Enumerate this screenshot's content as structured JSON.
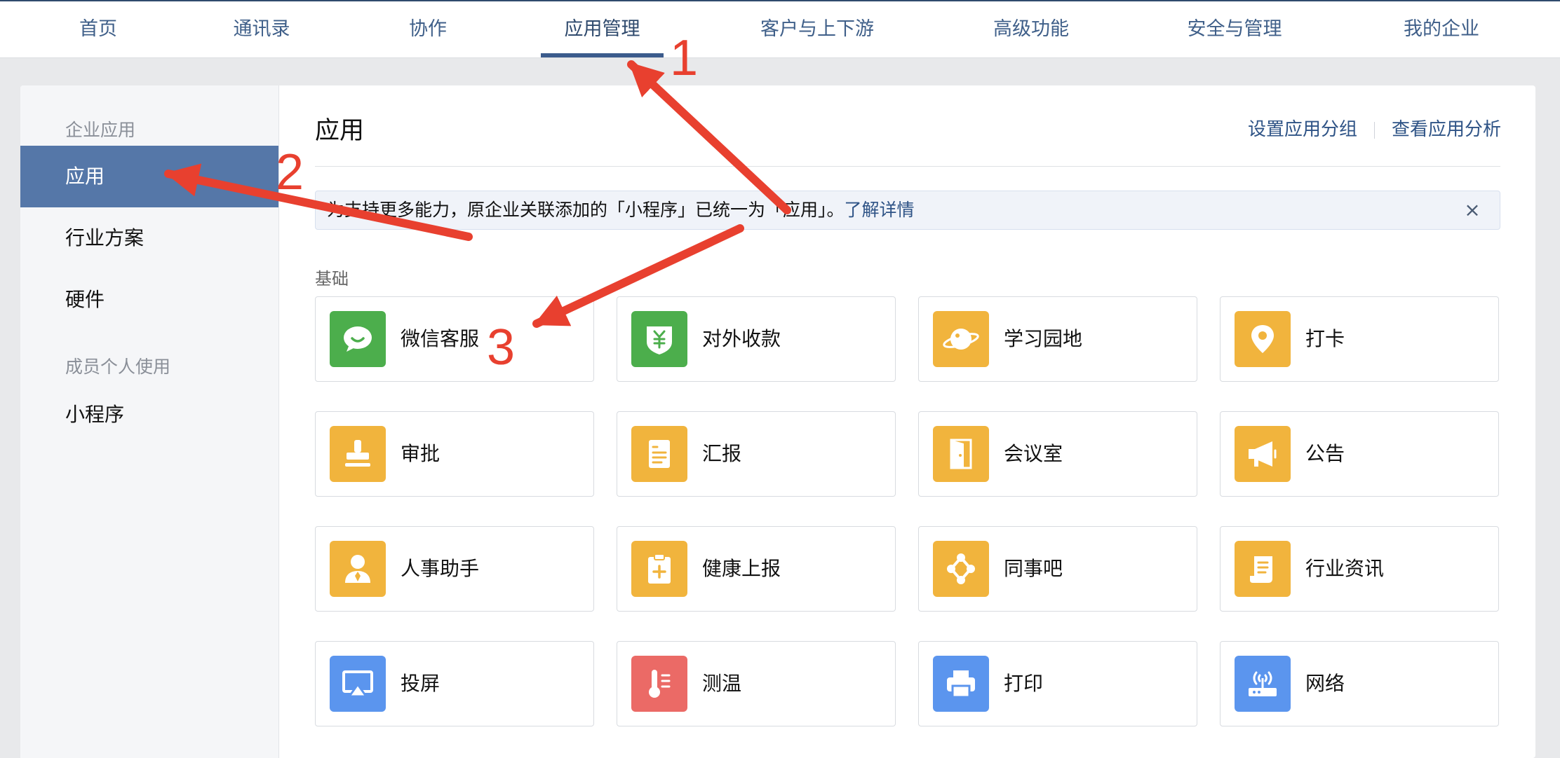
{
  "nav": {
    "items": [
      "首页",
      "通讯录",
      "协作",
      "应用管理",
      "客户与上下游",
      "高级功能",
      "安全与管理",
      "我的企业"
    ],
    "active": "应用管理"
  },
  "sidebar": {
    "group1": "企业应用",
    "items1": [
      "应用",
      "行业方案",
      "硬件"
    ],
    "group2": "成员个人使用",
    "items2": [
      "小程序"
    ],
    "active": "应用"
  },
  "main": {
    "title": "应用",
    "links": [
      "设置应用分组",
      "查看应用分析"
    ],
    "notice": {
      "text": "为支持更多能力，原企业关联添加的「小程序」已统一为「应用」。",
      "link": "了解详情",
      "close": "×"
    },
    "section": "基础",
    "apps": [
      {
        "label": "微信客服",
        "icon": "chat-icon",
        "color": "#4cae4c"
      },
      {
        "label": "对外收款",
        "icon": "yuan-shield-icon",
        "color": "#4cae4c"
      },
      {
        "label": "学习园地",
        "icon": "planet-icon",
        "color": "#f1b43d"
      },
      {
        "label": "打卡",
        "icon": "location-pin-icon",
        "color": "#f1b43d"
      },
      {
        "label": "审批",
        "icon": "stamp-icon",
        "color": "#f1b43d"
      },
      {
        "label": "汇报",
        "icon": "document-icon",
        "color": "#f1b43d"
      },
      {
        "label": "会议室",
        "icon": "door-icon",
        "color": "#f1b43d"
      },
      {
        "label": "公告",
        "icon": "megaphone-icon",
        "color": "#f1b43d"
      },
      {
        "label": "人事助手",
        "icon": "person-tie-icon",
        "color": "#f1b43d"
      },
      {
        "label": "健康上报",
        "icon": "clipboard-plus-icon",
        "color": "#f1b43d"
      },
      {
        "label": "同事吧",
        "icon": "network-icon",
        "color": "#f1b43d"
      },
      {
        "label": "行业资讯",
        "icon": "scroll-icon",
        "color": "#f1b43d"
      },
      {
        "label": "投屏",
        "icon": "airplay-icon",
        "color": "#5b95ee"
      },
      {
        "label": "测温",
        "icon": "thermometer-icon",
        "color": "#eb6a66"
      },
      {
        "label": "打印",
        "icon": "printer-icon",
        "color": "#5b95ee"
      },
      {
        "label": "网络",
        "icon": "router-icon",
        "color": "#5b95ee"
      }
    ]
  },
  "annotations": [
    "1",
    "2",
    "3"
  ]
}
